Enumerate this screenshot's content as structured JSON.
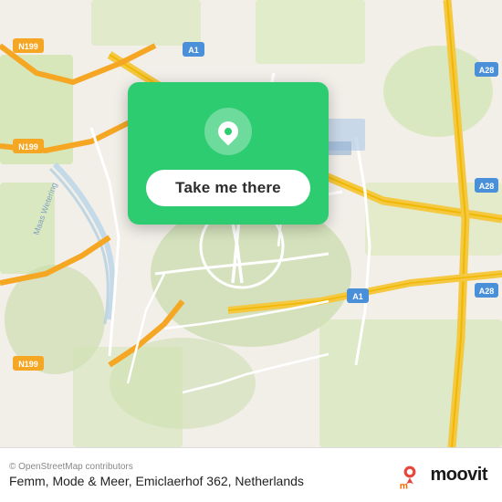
{
  "map": {
    "attribution": "© OpenStreetMap contributors",
    "center_lat": 52.38,
    "center_lon": 4.9,
    "zoom": 13
  },
  "popup": {
    "button_label": "Take me there",
    "pin_icon": "location-pin"
  },
  "footer": {
    "copyright": "© OpenStreetMap contributors",
    "address": "Femm, Mode & Meer, Emiclaerhof 362, Netherlands"
  },
  "branding": {
    "logo_text": "moovit",
    "logo_icon": "moovit-icon"
  },
  "road_labels": [
    "N199",
    "N199",
    "N199",
    "A1",
    "A28",
    "A28",
    "A28",
    "A1"
  ]
}
